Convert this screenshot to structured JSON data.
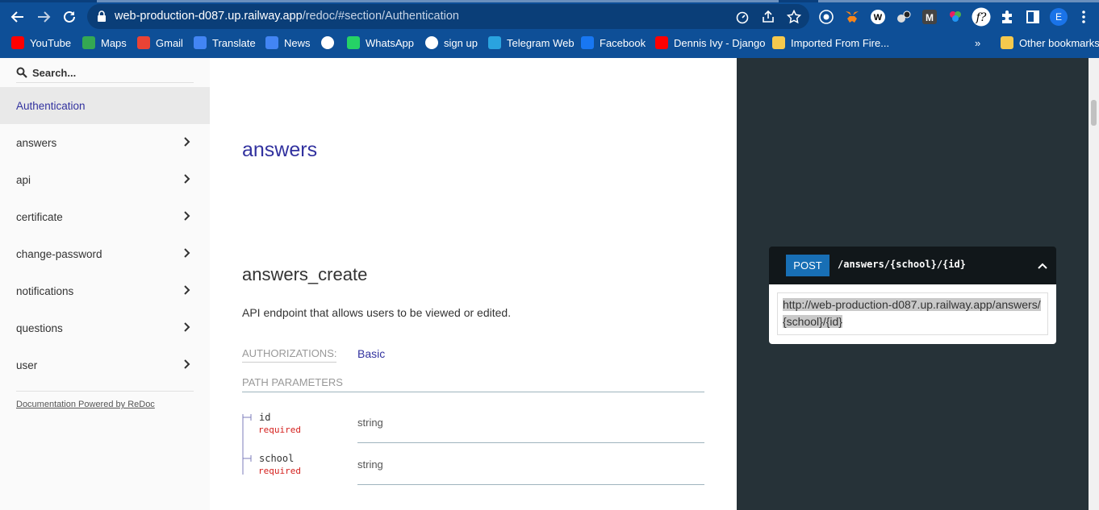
{
  "browser": {
    "url_host": "web-production-d087.up.railway.app",
    "url_path": "/redoc/#section/Authentication",
    "profile_initial": "E",
    "bookmarks": [
      {
        "label": "YouTube",
        "icon": "youtube-icon",
        "color": "#ff0000"
      },
      {
        "label": "Maps",
        "icon": "maps-icon",
        "color": "#34a853"
      },
      {
        "label": "Gmail",
        "icon": "gmail-icon",
        "color": "#ea4335"
      },
      {
        "label": "Translate",
        "icon": "translate-icon",
        "color": "#4285f4"
      },
      {
        "label": "News",
        "icon": "news-icon",
        "color": "#4285f4"
      },
      {
        "label": "",
        "icon": "globe-icon",
        "color": "#ffffff"
      },
      {
        "label": "WhatsApp",
        "icon": "whatsapp-icon",
        "color": "#25d366"
      },
      {
        "label": "sign up",
        "icon": "google-icon",
        "color": "#ffffff"
      },
      {
        "label": "Telegram Web",
        "icon": "telegram-icon",
        "color": "#2aa3df"
      },
      {
        "label": "Facebook",
        "icon": "facebook-icon",
        "color": "#1877f2"
      },
      {
        "label": "Dennis Ivy - Django",
        "icon": "youtube-icon",
        "color": "#ff0000"
      },
      {
        "label": "Imported From Fire...",
        "icon": "folder-icon",
        "color": "#f6c94d"
      }
    ],
    "more_label": "»",
    "other_bookmarks": "Other bookmarks"
  },
  "sidebar": {
    "search_placeholder": "Search...",
    "items": [
      {
        "label": "Authentication",
        "active": true
      },
      {
        "label": "answers"
      },
      {
        "label": "api"
      },
      {
        "label": "certificate"
      },
      {
        "label": "change-password"
      },
      {
        "label": "notifications"
      },
      {
        "label": "questions"
      },
      {
        "label": "user"
      }
    ],
    "powered_by": "Documentation Powered by ReDoc"
  },
  "content": {
    "section_title": "answers",
    "operation_title": "answers_create",
    "description": "API endpoint that allows users to be viewed or edited.",
    "auth_label": "AUTHORIZATIONS:",
    "auth_value": "Basic",
    "path_params_label": "PATH PARAMETERS",
    "params": [
      {
        "name": "id",
        "required": "required",
        "type": "string"
      },
      {
        "name": "school",
        "required": "required",
        "type": "string"
      }
    ]
  },
  "endpoint": {
    "method": "POST",
    "path": "/answers/{school}/{id}",
    "server_url_line1": "http://web-production-d087.up.railway.app/answers/",
    "server_url_line2": "{school}/{id}"
  },
  "colors": {
    "brand": "#32329f",
    "post_badge": "#186fb5",
    "required": "#d41f1c",
    "right_panel": "#263238"
  }
}
